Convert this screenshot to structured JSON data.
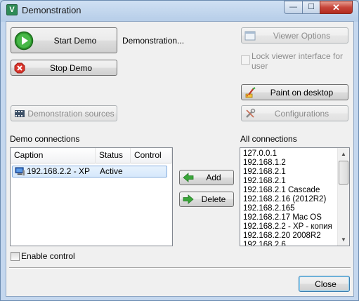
{
  "window": {
    "title": "Demonstration",
    "app_icon_glyph": "V",
    "min_glyph": "—",
    "max_glyph": "☐",
    "close_glyph": "✕"
  },
  "controls": {
    "start_demo": "Start Demo",
    "stop_demo": "Stop Demo",
    "status_text": "Demonstration...",
    "viewer_options": "Viewer Options",
    "lock_viewer": "Lock viewer interface for user",
    "paint_on_desktop": "Paint on desktop",
    "demonstration_sources": "Demonstration sources",
    "configurations": "Configurations"
  },
  "demo_connections": {
    "label": "Demo connections",
    "columns": [
      "Caption",
      "Status",
      "Control"
    ],
    "rows": [
      {
        "caption": "192.168.2.2 - XP",
        "status": "Active",
        "control": ""
      }
    ]
  },
  "actions": {
    "add": "Add",
    "delete": "Delete"
  },
  "all_connections": {
    "label": "All connections",
    "items": [
      "127.0.0.1",
      "192.168.1.2",
      "192.168.2.1",
      "192.168.2.1",
      "192.168.2.1 Cascade",
      "192.168.2.16 (2012R2)",
      "192.168.2.165",
      "192.168.2.17 Mac OS",
      "192.168.2.2 - XP - копия",
      "192.168.2.20 2008R2",
      "192.168.2.6"
    ]
  },
  "enable_control": "Enable control",
  "close": "Close",
  "icons": {
    "start": "play-circle-icon",
    "stop": "stop-x-icon",
    "viewer_options": "window-icon",
    "paint": "paint-brush-icon",
    "sources": "film-icon",
    "configurations": "wrench-icon",
    "computer": "computer-icon",
    "add": "arrow-left-icon",
    "delete": "arrow-right-icon"
  },
  "colors": {
    "play_green": "#2f9a2f",
    "stop_red": "#d9342b",
    "selection": "#d6e8fb",
    "arrow_green": "#3aa63a"
  }
}
